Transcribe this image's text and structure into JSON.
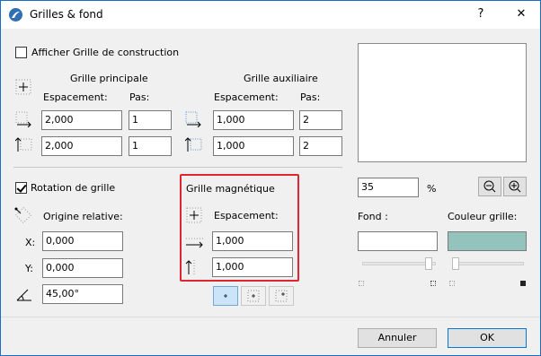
{
  "window": {
    "title": "Grilles & fond",
    "help_label": "?",
    "close_label": "✕"
  },
  "construction": {
    "show_label": "Afficher Grille de construction",
    "checked": false,
    "main_title": "Grille principale",
    "aux_title": "Grille auxiliaire",
    "spacing_label": "Espacement:",
    "step_label": "Pas:",
    "main": {
      "h_spacing": "2,000",
      "h_step": "1",
      "v_spacing": "2,000",
      "v_step": "1"
    },
    "aux": {
      "h_spacing": "1,000",
      "h_step": "2",
      "v_spacing": "1,000",
      "v_step": "2"
    }
  },
  "rotation": {
    "label": "Rotation de grille",
    "checked": true,
    "origin_label": "Origine relative:",
    "x_label": "X:",
    "y_label": "Y:",
    "x_value": "0,000",
    "y_value": "0,000",
    "angle_value": "45,00°"
  },
  "snap": {
    "title": "Grille magnétique",
    "spacing_label": "Espacement:",
    "h_value": "1,000",
    "v_value": "1,000"
  },
  "preview": {
    "zoom_value": "35",
    "zoom_unit": "%",
    "background_label": "Fond :",
    "grid_color_label": "Couleur grille:",
    "background_color": "#ffffff",
    "grid_color": "#94c2bd"
  },
  "footer": {
    "cancel_label": "Annuler",
    "ok_label": "OK"
  }
}
